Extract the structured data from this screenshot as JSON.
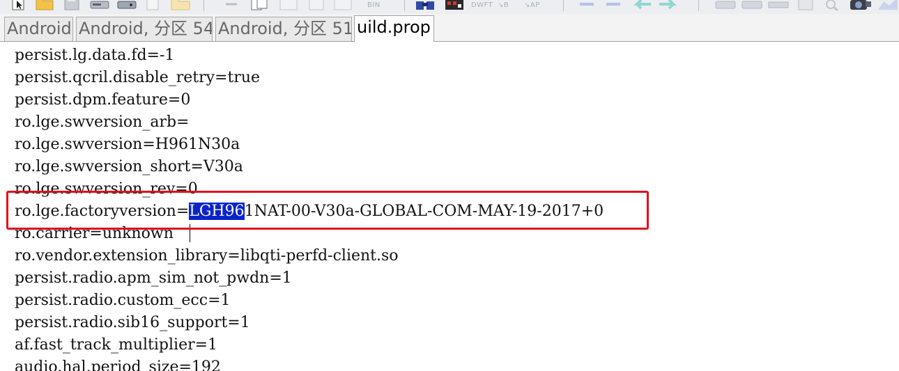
{
  "tabs": [
    {
      "label": "Android",
      "active": false
    },
    {
      "label": "Android, 分区 54",
      "active": false
    },
    {
      "label": "Android, 分区 51",
      "active": false
    },
    {
      "label": "uild.prop",
      "active": true
    }
  ],
  "editor": {
    "lines": [
      "persist.lg.data.fd=-1",
      "persist.qcril.disable_retry=true",
      "persist.dpm.feature=0",
      "ro.lge.swversion_arb=",
      "ro.lge.swversion=H961N30a",
      "ro.lge.swversion_short=V30a",
      "ro.lge.swversion_rev=0",
      "ro.lge.factoryversion=LGH961NAT-00-V30a-GLOBAL-COM-MAY-19-2017+0",
      "ro.carrier=unknown",
      "ro.vendor.extension_library=libqti-perfd-client.so",
      "persist.radio.apm_sim_not_pwdn=1",
      "persist.radio.custom_ecc=1",
      "persist.radio.sib16_support=1",
      "af.fast_track_multiplier=1",
      "audio.hal.period_size=192"
    ],
    "highlighted_line": {
      "prefix": "ro.lge.factoryversion=",
      "selected": "LGH96",
      "suffix": "1NAT-00-V30a-GLOBAL-COM-MAY-19-2017+0"
    }
  },
  "toolbar": {
    "captions": [
      "BIN",
      "DWFT",
      "↘B",
      "↘AP"
    ]
  },
  "colors": {
    "selection": "#0a24c8",
    "annotation": "#e0101c",
    "tab_active_bg": "#ffffff",
    "tab_inactive_bg": "#e9e9e9"
  }
}
